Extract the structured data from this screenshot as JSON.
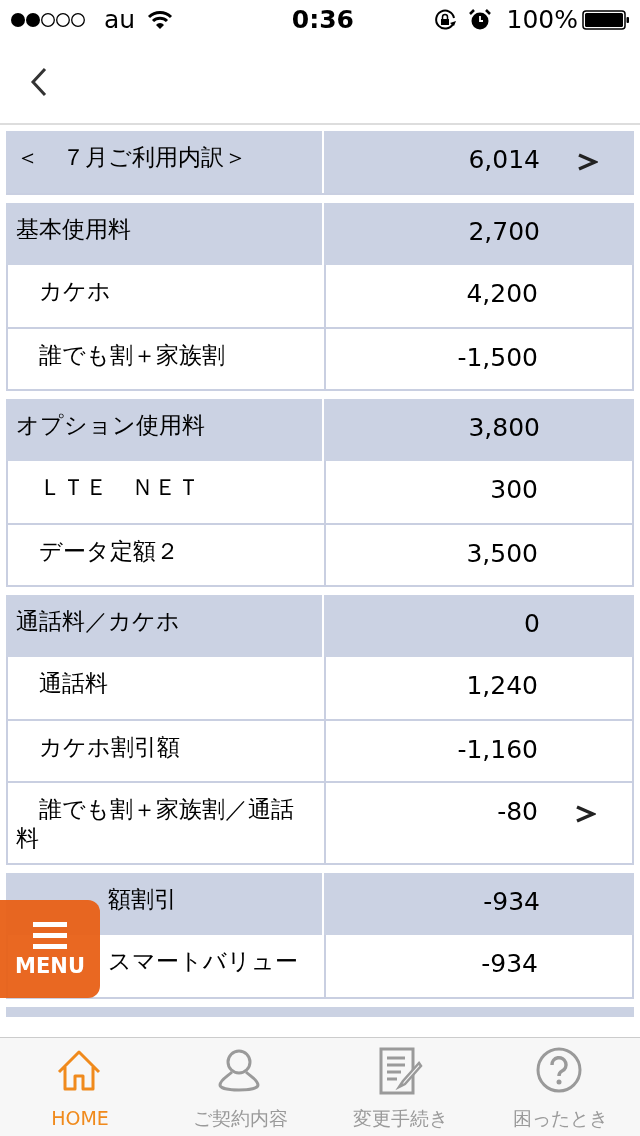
{
  "status_bar": {
    "carrier": "au",
    "time": "0:36",
    "battery": "100%"
  },
  "sections": [
    {
      "header": {
        "label": "＜　７月ご利用内訳＞",
        "amount": "6,014",
        "arrow": true
      }
    },
    {
      "header": {
        "label": "基本使用料",
        "amount": "2,700",
        "arrow": false
      },
      "items": [
        {
          "label": "　カケホ",
          "amount": "4,200",
          "arrow": false
        },
        {
          "label": "　誰でも割＋家族割",
          "amount": "-1,500",
          "arrow": false
        }
      ]
    },
    {
      "header": {
        "label": "オプション使用料",
        "amount": "3,800",
        "arrow": false
      },
      "items": [
        {
          "label": "　ＬＴＥ　ＮＥＴ",
          "amount": "300",
          "arrow": false
        },
        {
          "label": "　データ定額２",
          "amount": "3,500",
          "arrow": false
        }
      ]
    },
    {
      "header": {
        "label": "通話料／カケホ",
        "amount": "0",
        "arrow": false
      },
      "items": [
        {
          "label": "　通話料",
          "amount": "1,240",
          "arrow": false
        },
        {
          "label": "　カケホ割引額",
          "amount": "-1,160",
          "arrow": false
        },
        {
          "label": "　誰でも割＋家族割／通話料",
          "amount": "-80",
          "arrow": true
        }
      ]
    },
    {
      "header": {
        "label": "　　　　額割引",
        "amount": "-934",
        "arrow": false
      },
      "items": [
        {
          "label": "　　　　スマートバリュー",
          "amount": "-934",
          "arrow": false
        }
      ]
    }
  ],
  "menu_button": {
    "label": "MENU"
  },
  "tab_bar": [
    {
      "label": "HOME",
      "selected": true
    },
    {
      "label": "ご契約内容",
      "selected": false
    },
    {
      "label": "変更手続き",
      "selected": false
    },
    {
      "label": "困ったとき",
      "selected": false
    }
  ]
}
